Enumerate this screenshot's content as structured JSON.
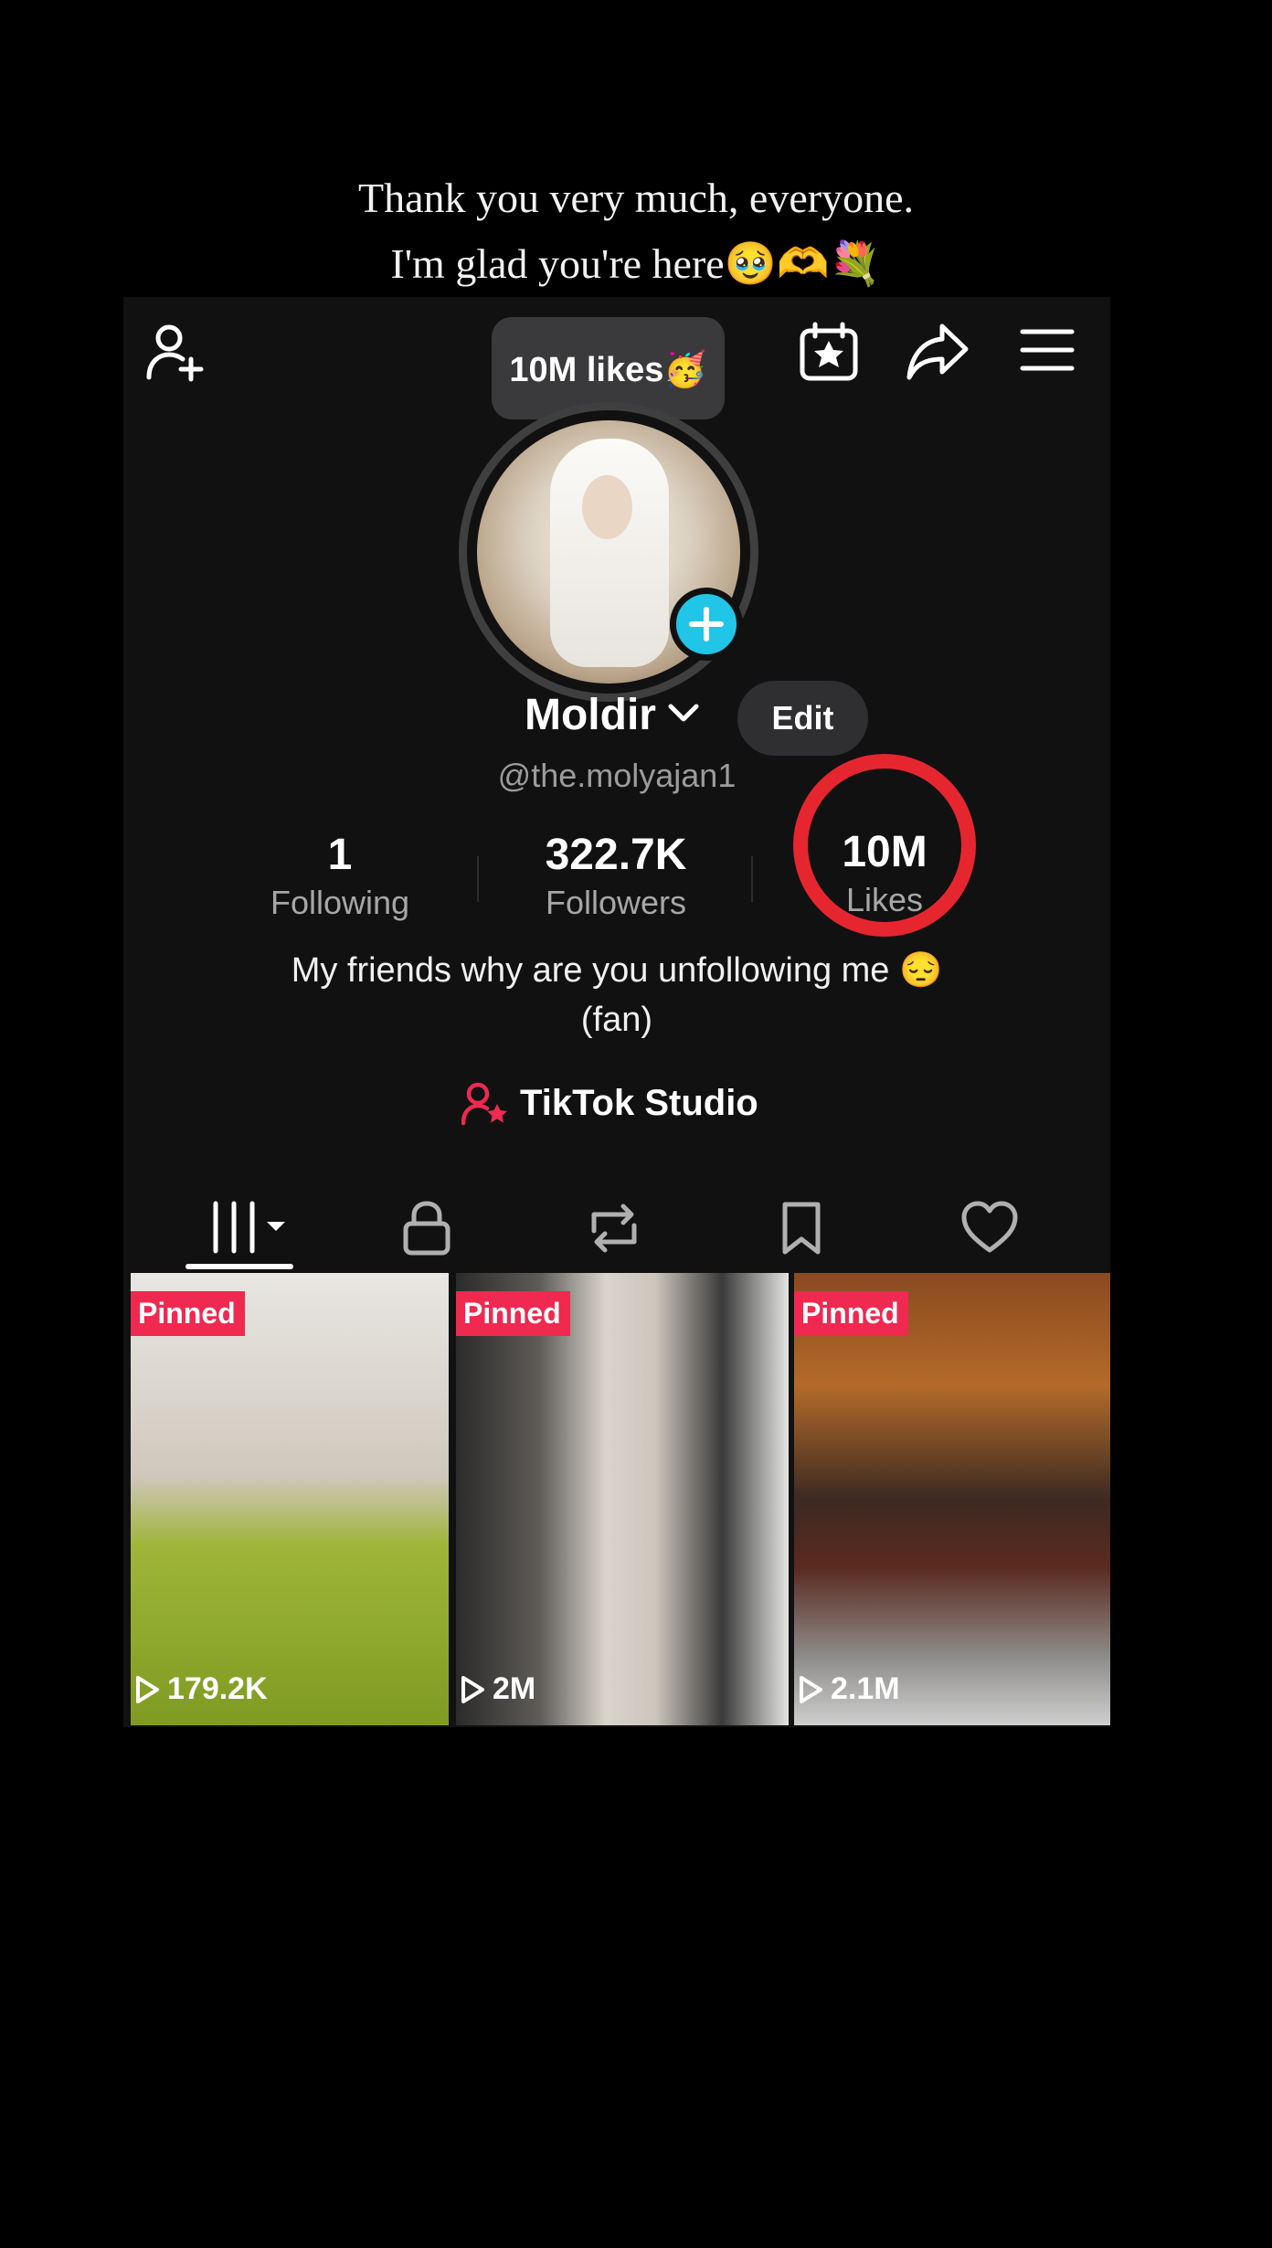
{
  "caption": {
    "line1": "Thank you very much, everyone.",
    "line2": "I'm glad you're here🥹🫶💐"
  },
  "header": {
    "tooltip": "10M likes🥳",
    "icons": [
      "add-friend-icon",
      "calendar-star-icon",
      "share-icon",
      "menu-icon"
    ]
  },
  "profile": {
    "name": "Moldir",
    "edit_label": "Edit",
    "handle": "@the.molyajan1"
  },
  "stats": {
    "following_count": "1",
    "following_label": "Following",
    "followers_count": "322.7K",
    "followers_label": "Followers",
    "likes_count": "10M",
    "likes_label": "Likes"
  },
  "bio": {
    "line1": "My friends why are you unfollowing me 😔",
    "line2": "(fan)"
  },
  "studio": {
    "label": "TikTok Studio"
  },
  "tabs": [
    "videos-grid-icon",
    "lock-icon",
    "repost-icon",
    "bookmark-icon",
    "heart-icon"
  ],
  "videos": [
    {
      "badge": "Pinned",
      "views": "179.2K"
    },
    {
      "badge": "Pinned",
      "views": "2M"
    },
    {
      "badge": "Pinned",
      "views": "2.1M"
    }
  ],
  "colors": {
    "accent_red": "#ef2950",
    "badge_cyan": "#20c5e8",
    "circle_red": "#e6262e"
  }
}
